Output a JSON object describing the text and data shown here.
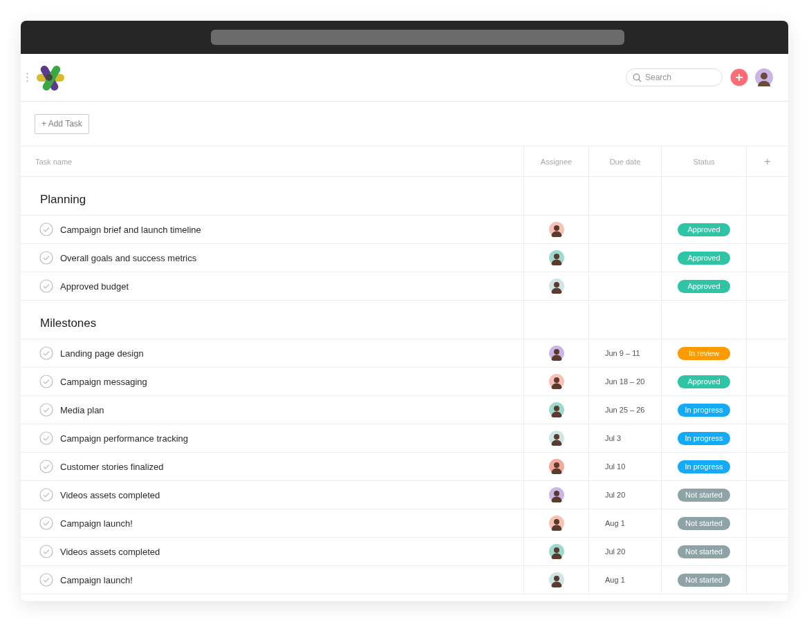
{
  "search": {
    "placeholder": "Search"
  },
  "toolbar": {
    "add_task": "+ Add Task"
  },
  "table": {
    "columns": [
      "Task name",
      "Assignee",
      "Due date",
      "Status",
      "+"
    ],
    "rows": [
      {
        "kind": "section",
        "title": "Planning"
      },
      {
        "kind": "task",
        "name": "Campaign brief and launch timeline",
        "due": "",
        "status": "Approved",
        "color": "#2ec4a5"
      },
      {
        "kind": "task",
        "name": "Overall goals and success metrics",
        "due": "",
        "status": "Approved",
        "color": "#2ec4a5"
      },
      {
        "kind": "task",
        "name": "Approved budget",
        "due": "",
        "status": "Approved",
        "color": "#2ec4a5"
      },
      {
        "kind": "section",
        "title": "Milestones"
      },
      {
        "kind": "task",
        "name": "Landing page design",
        "due": "Jun 9 – 11",
        "status": "In review",
        "color": "#fd9a00"
      },
      {
        "kind": "task",
        "name": "Campaign messaging",
        "due": "Jun 18 – 20",
        "status": "Approved",
        "color": "#2ec4a5"
      },
      {
        "kind": "task",
        "name": "Media plan",
        "due": "Jun 25 – 26",
        "status": "In progress",
        "color": "#14aaf5"
      },
      {
        "kind": "task",
        "name": "Campaign performance tracking",
        "due": "Jul 3",
        "status": "In progress",
        "color": "#14aaf5"
      },
      {
        "kind": "task",
        "name": "Customer stories finalized",
        "due": "Jul 10",
        "status": "In progress",
        "color": "#14aaf5"
      },
      {
        "kind": "task",
        "name": "Videos assets completed",
        "due": "Jul 20",
        "status": "Not started",
        "color": "#8da3a6"
      },
      {
        "kind": "task",
        "name": "Campaign launch!",
        "due": "Aug 1",
        "status": "Not started",
        "color": "#8da3a6"
      },
      {
        "kind": "task",
        "name": "Videos assets completed",
        "due": "Jul 20",
        "status": "Not started",
        "color": "#8da3a6"
      },
      {
        "kind": "task",
        "name": "Campaign launch!",
        "due": "Aug 1",
        "status": "Not started",
        "color": "#8da3a6"
      }
    ]
  }
}
